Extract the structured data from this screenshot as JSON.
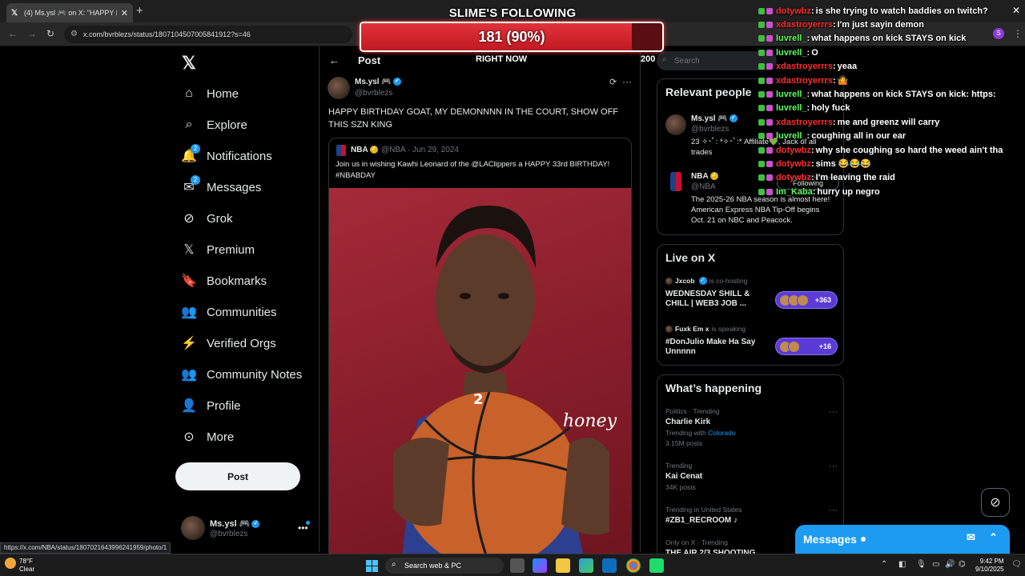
{
  "browser": {
    "tab_title": "(4) Ms.ysl 🎮 on X: \"HAPPY BIRT",
    "url": "x.com/bvrblezs/status/1807104507005841912?s=46",
    "status_url": "https://x.com/NBA/status/1807021643996241959/photo/1",
    "profile_letter": "S"
  },
  "sidebar": {
    "items": [
      {
        "label": "Home",
        "icon": "home-icon"
      },
      {
        "label": "Explore",
        "icon": "search-icon"
      },
      {
        "label": "Notifications",
        "icon": "bell-icon",
        "badge": "2"
      },
      {
        "label": "Messages",
        "icon": "mail-icon",
        "badge": "2"
      },
      {
        "label": "Grok",
        "icon": "grok-icon"
      },
      {
        "label": "Premium",
        "icon": "x-logo-icon"
      },
      {
        "label": "Bookmarks",
        "icon": "bookmark-icon"
      },
      {
        "label": "Communities",
        "icon": "communities-icon"
      },
      {
        "label": "Verified Orgs",
        "icon": "lightning-icon"
      },
      {
        "label": "Community Notes",
        "icon": "community-notes-icon"
      },
      {
        "label": "Profile",
        "icon": "person-icon"
      },
      {
        "label": "More",
        "icon": "more-circle-icon"
      }
    ],
    "post_label": "Post",
    "account": {
      "name": "Ms.ysl 🎮",
      "handle": "@bvrblezs"
    }
  },
  "main": {
    "header": "Post",
    "tweet": {
      "name": "Ms.ysl 🎮",
      "handle": "@bvrblezs",
      "text": "HAPPY BIRTHDAY GOAT, MY DEMONNNN IN THE COURT, SHOW OFF THIS SZN KING"
    },
    "quote": {
      "name": "NBA",
      "meta": "@NBA · Jun 29, 2024",
      "text": "Join us in wishing Kawhi Leonard of the @LAClippers a HAPPY 33rd BIRTHDAY! #NBABDAY",
      "jersey_text": "honey",
      "jersey_number": "2"
    }
  },
  "right": {
    "search_placeholder": "Search",
    "relevant": {
      "title": "Relevant people",
      "people": [
        {
          "name": "Ms.ysl 🎮",
          "handle": "@bvrblezs",
          "bio": "23 ✧･ﾟ: *✧･ﾟ:* Affiliate💚, Jack of all trades"
        },
        {
          "name": "NBA",
          "handle": "@NBA",
          "bio": "The 2025-26 NBA season is almost here! American Express NBA Tip-Off begins Oct. 21 on NBC and Peacock."
        }
      ],
      "follow_label": "Following"
    },
    "live": {
      "title": "Live on X",
      "items": [
        {
          "host": "Jxcob",
          "status": "is co-hosting",
          "title": "WEDNESDAY SHILL & CHILL | WEB3 JOB ...",
          "count": "+363"
        },
        {
          "host": "Fuxk Em x",
          "status": "is speaking",
          "title": "#DonJulio Make Ha Say Unnnnn",
          "count": "+16"
        }
      ]
    },
    "happening": {
      "title": "What’s happening",
      "trends": [
        {
          "meta": "Politics · Trending",
          "name": "Charlie Kirk",
          "sub_prefix": "Trending with ",
          "sub_link": "Colorado",
          "posts": "3.15M posts"
        },
        {
          "meta": "Trending",
          "name": "Kai Cenat",
          "posts": "34K posts"
        },
        {
          "meta": "Trending in United States",
          "name": "#ZB1_RECROOM ♪"
        },
        {
          "meta": "Only on X · Trending",
          "name": "THE AIR 2/3 SHOOTING"
        }
      ]
    },
    "messages_drawer": "Messages"
  },
  "overlay": {
    "goal_title": "SLIME'S FOLLOWING",
    "goal_text": "181 (90%)",
    "goal_progress": 0.9,
    "right_now": "RIGHT NOW",
    "goal_target": "200",
    "chat": [
      {
        "user": "dotywbz",
        "color": "#ff2d2d",
        "msg": "is she trying to watch baddies on twitch?"
      },
      {
        "user": "xdastroyerrrs",
        "color": "#ff2d2d",
        "msg": "I'm just sayin demon"
      },
      {
        "user": "luvrell_",
        "color": "#59ff59",
        "msg": "what happens on kick STAYS on kick"
      },
      {
        "user": "luvrell_",
        "color": "#59ff59",
        "msg": "O"
      },
      {
        "user": "xdastroyerrrs",
        "color": "#ff2d2d",
        "msg": "yeaa"
      },
      {
        "user": "xdastroyerrrs",
        "color": "#ff2d2d",
        "msg": "🤷"
      },
      {
        "user": "luvrell_",
        "color": "#59ff59",
        "msg": "what happens on kick STAYS on kick: https:"
      },
      {
        "user": "luvrell_",
        "color": "#59ff59",
        "msg": "holy fuck"
      },
      {
        "user": "xdastroyerrrs",
        "color": "#ff2d2d",
        "msg": "me and greenz will carry"
      },
      {
        "user": "luvrell_",
        "color": "#59ff59",
        "msg": "coughing all in our ear"
      },
      {
        "user": "dotywbz",
        "color": "#ff2d2d",
        "msg": "why she coughing so hard the weed ain't tha"
      },
      {
        "user": "dotywbz",
        "color": "#ff2d2d",
        "msg": "sims 😂😂😂"
      },
      {
        "user": "dotywbz",
        "color": "#ff2d2d",
        "msg": "I'm leaving the raid"
      },
      {
        "user": "Im_Kaba",
        "color": "#59ff59",
        "msg": "hurry up negro"
      }
    ]
  },
  "taskbar": {
    "temp": "78°F",
    "condition": "Clear",
    "search_label": "Search web & PC",
    "time": "9:42 PM",
    "date": "9/10/2025"
  }
}
